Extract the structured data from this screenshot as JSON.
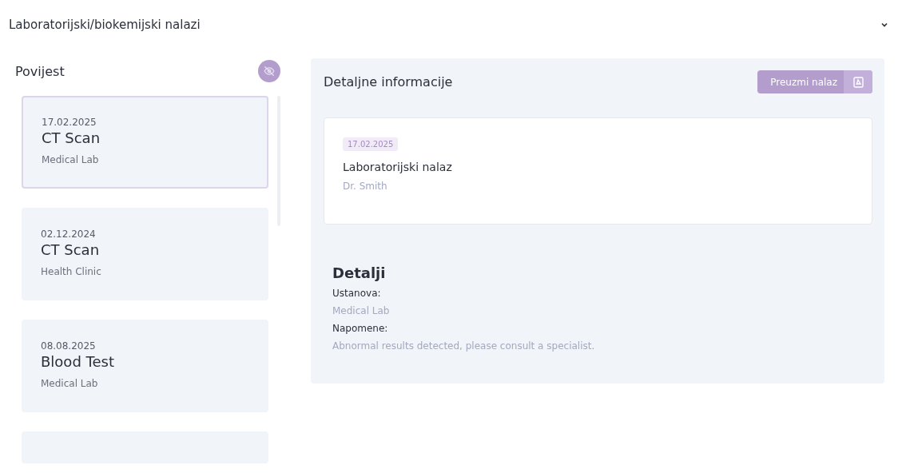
{
  "section": {
    "title": "Laboratorijski/biokemijski nalazi",
    "expanded": true
  },
  "history": {
    "title": "Povijest",
    "items": [
      {
        "date": "17.02.2025",
        "name": "CT Scan",
        "institution": "Medical Lab",
        "selected": true
      },
      {
        "date": "02.12.2024",
        "name": "CT Scan",
        "institution": "Health Clinic",
        "selected": false
      },
      {
        "date": "08.08.2025",
        "name": "Blood Test",
        "institution": "Medical Lab",
        "selected": false
      }
    ]
  },
  "details": {
    "title": "Detaljne informacije",
    "download_button": "Preuzmi nalaz",
    "card": {
      "date": "17.02.2025",
      "title": "Laboratorijski nalaz",
      "doctor": "Dr. Smith"
    },
    "section_title": "Detalji",
    "fields": [
      {
        "label": "Ustanova:",
        "value": "Medical Lab"
      },
      {
        "label": "Napomene:",
        "value": "Abnormal results detected, please consult a specialist."
      }
    ]
  }
}
